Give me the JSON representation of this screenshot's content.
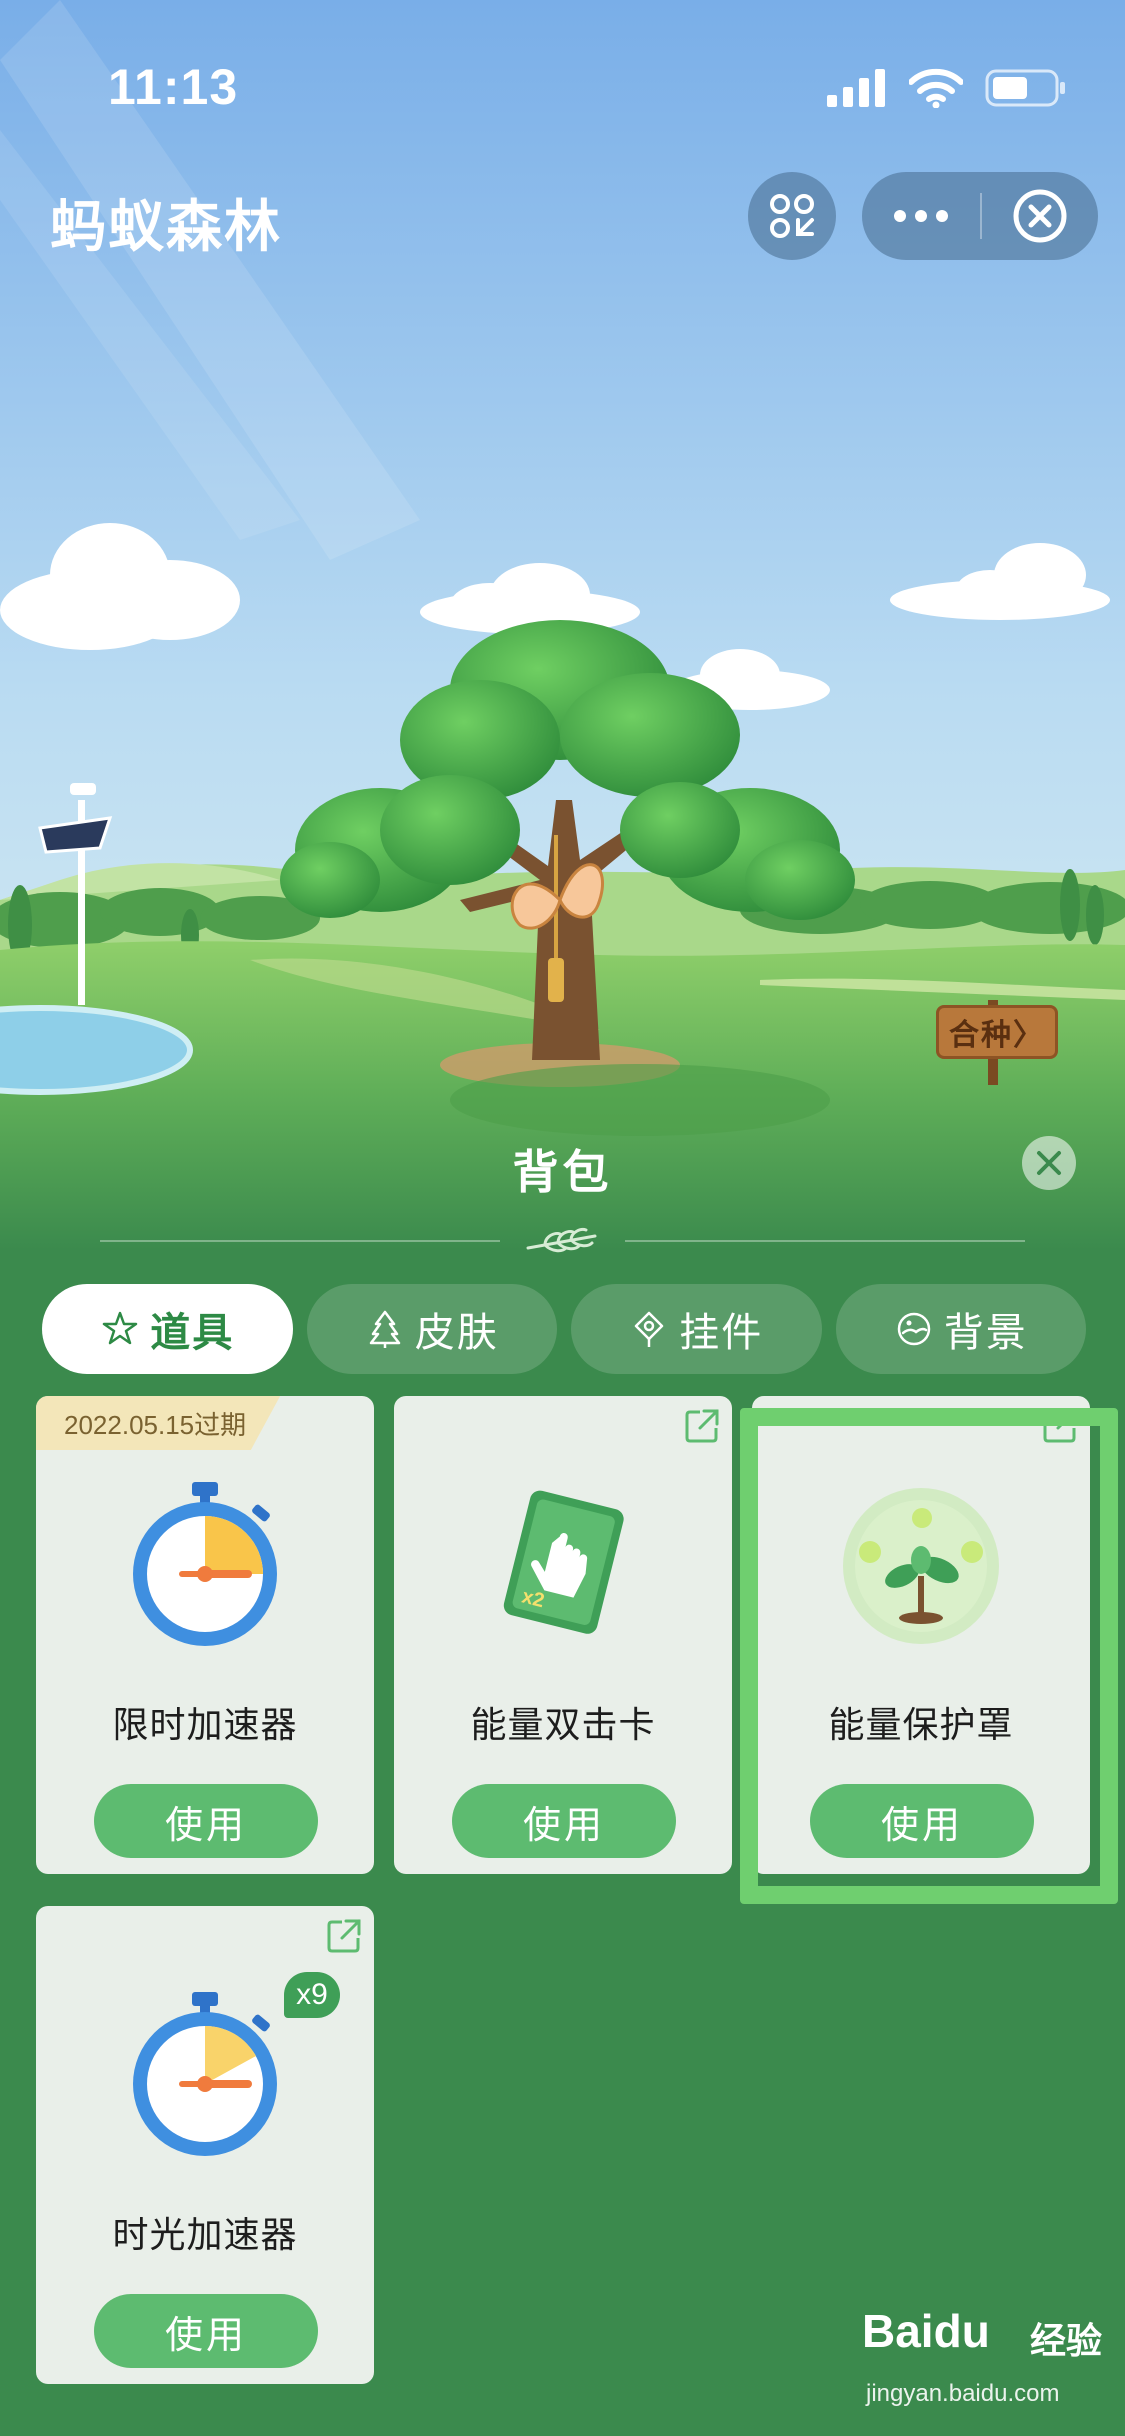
{
  "status_bar": {
    "time": "11:13"
  },
  "header": {
    "title": "蚂蚁森林"
  },
  "scene": {
    "sign_label": "合种〉"
  },
  "panel": {
    "title": "背包",
    "tabs": [
      {
        "label": "道具",
        "icon": "star-icon",
        "active": true
      },
      {
        "label": "皮肤",
        "icon": "tree-icon",
        "active": false
      },
      {
        "label": "挂件",
        "icon": "pendant-icon",
        "active": false
      },
      {
        "label": "背景",
        "icon": "landscape-icon",
        "active": false
      }
    ],
    "items": [
      {
        "name": "限时加速器",
        "button": "使用",
        "expire": "2022.05.15过期",
        "icon": "stopwatch-icon"
      },
      {
        "name": "能量双击卡",
        "button": "使用",
        "icon": "double-hit-card-icon"
      },
      {
        "name": "能量保护罩",
        "button": "使用",
        "icon": "energy-shield-icon"
      },
      {
        "name": "时光加速器",
        "button": "使用",
        "count": "x9",
        "icon": "stopwatch-icon"
      }
    ]
  },
  "watermark": {
    "brand": "Bai",
    "brand_paw": "du",
    "cn": "经验",
    "url": "jingyan.baidu.com"
  },
  "colors": {
    "accent_green": "#5dbb70",
    "tab_active_text": "#2d8a45",
    "panel_bg": "#3b8a4d",
    "highlight": "#6fcf6f"
  }
}
